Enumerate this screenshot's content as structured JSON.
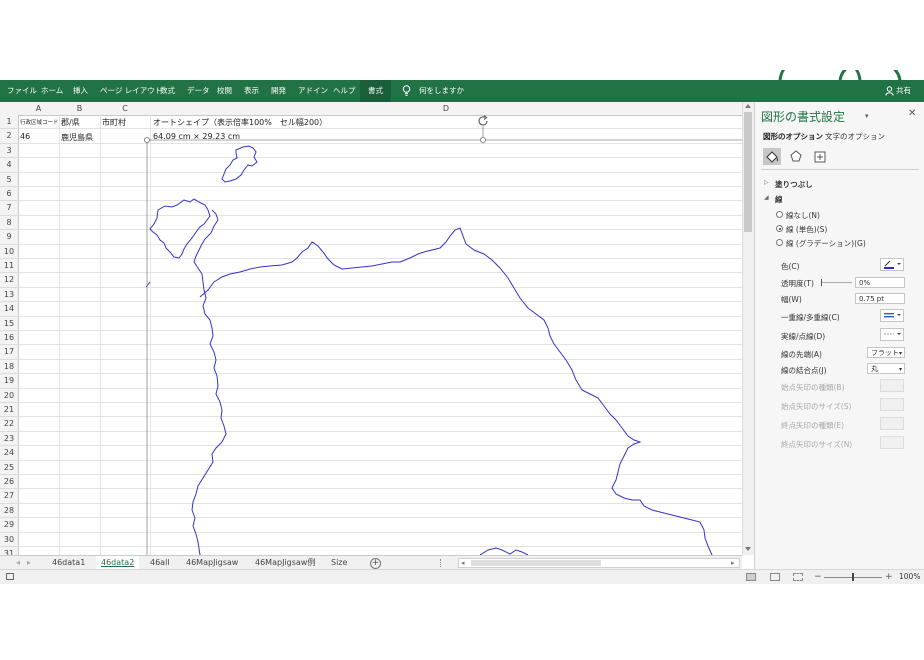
{
  "ribbon": {
    "tabs": [
      "ファイル",
      "ホーム",
      "挿入",
      "ページ レイアウト",
      "数式",
      "データ",
      "校閲",
      "表示",
      "開発",
      "アドイン",
      "ヘルプ",
      "書式"
    ],
    "active_tab": "書式",
    "tell_me": "何をしますか",
    "share": "共有"
  },
  "sheet": {
    "columns": [
      "A",
      "B",
      "C",
      "D"
    ],
    "rows": [
      "1",
      "2",
      "3",
      "4",
      "5",
      "6",
      "7",
      "8",
      "9",
      "10",
      "11",
      "12",
      "13",
      "14",
      "15",
      "16",
      "17",
      "18",
      "19",
      "20",
      "21",
      "22",
      "23",
      "24",
      "25",
      "26",
      "27",
      "28",
      "29",
      "30",
      "31"
    ],
    "cells": {
      "a1": "行政区域コード",
      "b1": "郡/県",
      "c1": "市町村",
      "d1": "オートシェイプ（表示倍率100%　セル幅200）",
      "a2": "46",
      "b2": "鹿児島県",
      "d2": "64.09 cm × 29.23 cm"
    }
  },
  "sheet_tabs": [
    "46data1",
    "46data2",
    "46all",
    "46MapJigsaw",
    "46MapJigsaw例",
    "Size"
  ],
  "active_sheet": "46data2",
  "status": {
    "zoom": "100%"
  },
  "panel": {
    "title": "図形の書式設定",
    "tab_shape": "図形のオプション",
    "tab_text": "文字のオプション",
    "fill_section": "塗りつぶし",
    "line_section": "線",
    "line_none": "線なし(N)",
    "line_solid": "線 (単色)(S)",
    "line_gradient": "線 (グラデーション)(G)",
    "color_label": "色(C)",
    "transparency_label": "透明度(T)",
    "transparency_value": "0%",
    "width_label": "幅(W)",
    "width_value": "0.75 pt",
    "compound_label": "一重線/多重線(C)",
    "dash_label": "実線/点線(D)",
    "cap_label": "線の先端(A)",
    "cap_value": "フラット",
    "join_label": "線の結合点(J)",
    "join_value": "丸",
    "begin_arrow_type": "始点矢印の種類(B)",
    "begin_arrow_size": "始点矢印のサイズ(S)",
    "end_arrow_type": "終点矢印の種類(E)",
    "end_arrow_size": "終点矢印のサイズ(N)"
  },
  "colors": {
    "ribbon": "#217346",
    "outline": "#3333cc"
  }
}
